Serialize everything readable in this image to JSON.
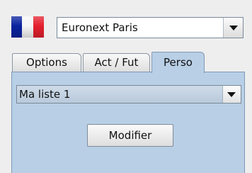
{
  "market": {
    "flag_icon": "france-flag-icon",
    "flag_colors": [
      "#0a239f",
      "#f6f6f6",
      "#e4202e"
    ],
    "selected": "Euronext Paris"
  },
  "tabs": [
    {
      "label": "Options",
      "selected": false
    },
    {
      "label": "Act / Fut",
      "selected": false
    },
    {
      "label": "Perso",
      "selected": true
    }
  ],
  "perso": {
    "list_selected": "Ma liste 1",
    "modify_label": "Modifier"
  },
  "colors": {
    "panel_background": "#b8cfe6",
    "window_background": "#eeeeee"
  }
}
